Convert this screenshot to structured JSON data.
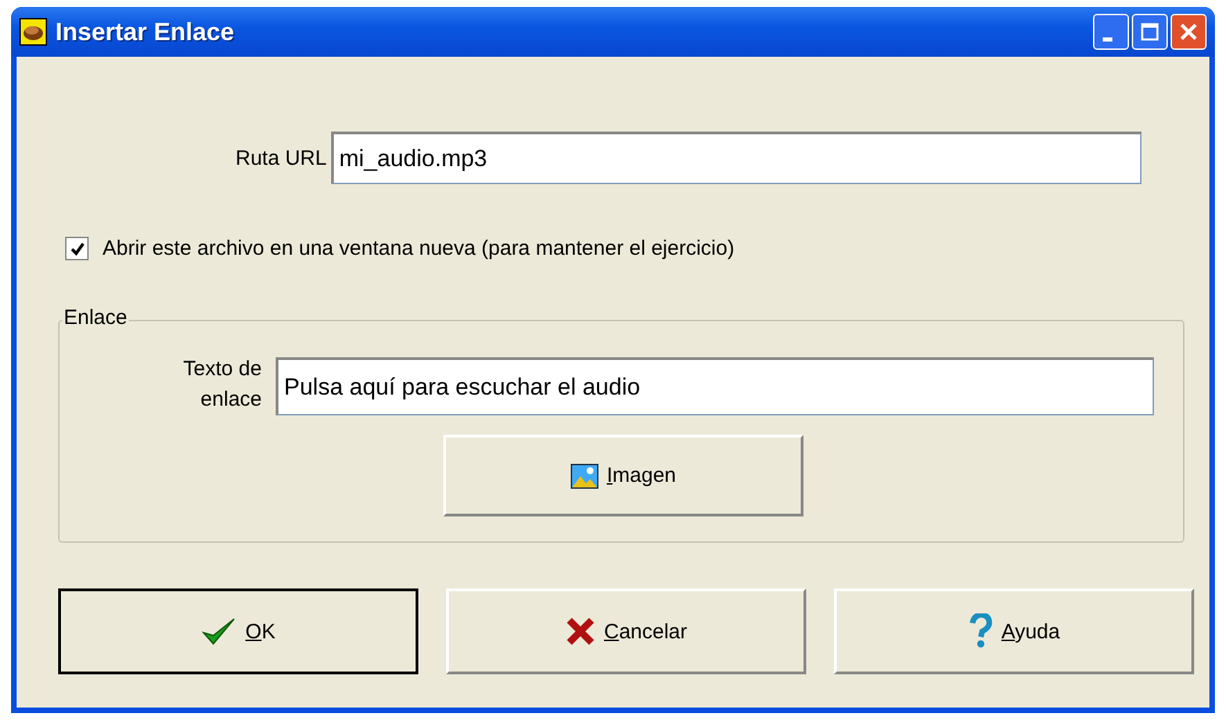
{
  "window": {
    "title": "Insertar Enlace"
  },
  "url": {
    "label": "Ruta URL",
    "value": "mi_audio.mp3"
  },
  "new_window": {
    "label": "Abrir este archivo en una ventana nueva (para mantener el ejercicio)",
    "checked": true
  },
  "group": {
    "title": "Enlace",
    "text_label": "Texto de enlace",
    "text_value": "Pulsa aquí para escuchar el audio",
    "image_button": {
      "accel": "I",
      "rest": "magen"
    }
  },
  "buttons": [
    {
      "kind": "ok",
      "accel": "O",
      "rest": "K",
      "default": true
    },
    {
      "kind": "cancel",
      "accel": "C",
      "rest": "ancelar",
      "default": false
    },
    {
      "kind": "help",
      "accel": "A",
      "rest": "yuda",
      "default": false
    }
  ]
}
